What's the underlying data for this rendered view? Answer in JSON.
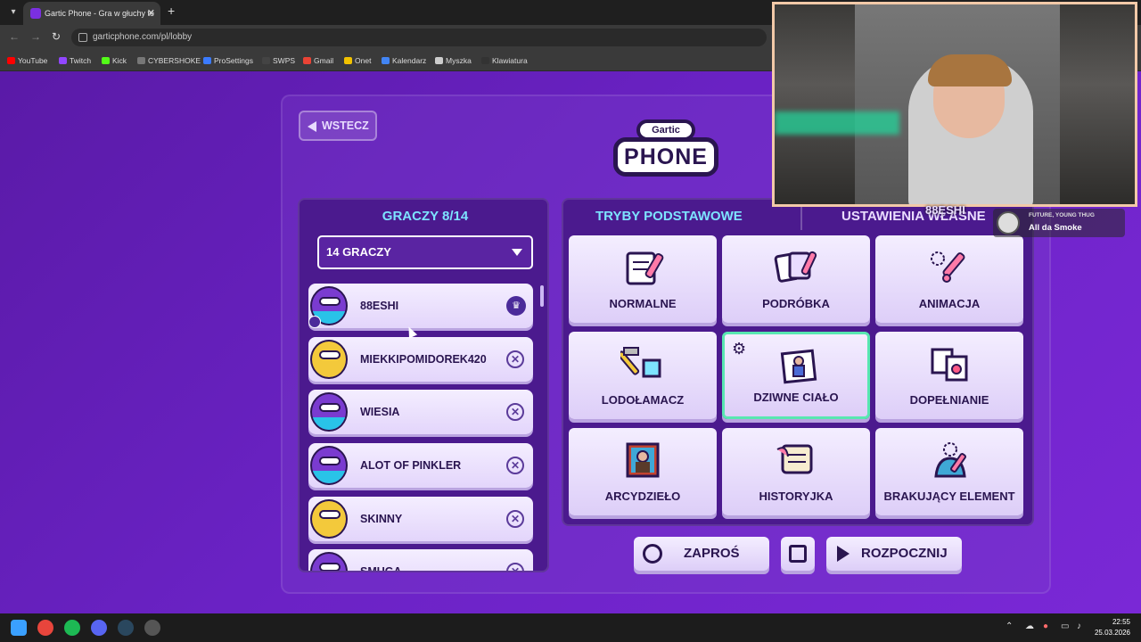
{
  "browser": {
    "tab_title": "Gartic Phone - Gra w głuchy te",
    "url": "garticphone.com/pl/lobby",
    "bookmarks": [
      "YouTube",
      "Twitch",
      "Kick",
      "CYBERSHOKE",
      "ProSettings",
      "SWPS",
      "Gmail",
      "Onet",
      "Kalendarz",
      "Myszka",
      "Klawiatura"
    ]
  },
  "page": {
    "back_label": "WSTECZ",
    "logo_top": "Gartic",
    "logo_bottom": "PHONE",
    "players_title": "GRACZY 8/14",
    "player_count_select": "14 GRACZY",
    "players": [
      {
        "name": "88ESHI",
        "host": true
      },
      {
        "name": "MIEKKIPOMIDOREK420",
        "host": false
      },
      {
        "name": "WIESIA",
        "host": false
      },
      {
        "name": "ALOT OF PINKLER",
        "host": false
      },
      {
        "name": "SKINNY",
        "host": false
      },
      {
        "name": "SMUGA",
        "host": false
      }
    ],
    "modes_tab_active": "TRYBY PODSTAWOWE",
    "modes_tab_other": "USTAWIENIA WŁASNE",
    "modes": [
      {
        "label": "NORMALNE",
        "icon": "notebook-pencil-icon",
        "selected": false
      },
      {
        "label": "PODRÓBKA",
        "icon": "cards-pencil-icon",
        "selected": false
      },
      {
        "label": "ANIMACJA",
        "icon": "animation-pencil-icon",
        "selected": false
      },
      {
        "label": "LODOŁAMACZ",
        "icon": "icebreaker-icon",
        "selected": false
      },
      {
        "label": "DZIWNE CIAŁO",
        "icon": "strange-body-icon",
        "selected": true
      },
      {
        "label": "DOPEŁNIANIE",
        "icon": "complement-icon",
        "selected": false
      },
      {
        "label": "ARCYDZIEŁO",
        "icon": "masterpiece-icon",
        "selected": false
      },
      {
        "label": "HISTORYJKA",
        "icon": "story-scroll-icon",
        "selected": false
      },
      {
        "label": "BRAKUJĄCY ELEMENT",
        "icon": "missing-piece-icon",
        "selected": false
      }
    ],
    "invite_label": "ZAPROŚ",
    "start_label": "ROZPOCZNIJ"
  },
  "overlay": {
    "streamer_name": "88ESHI",
    "now_playing_artist": "FUTURE, YOUNG THUG",
    "now_playing_track": "All da Smoke"
  },
  "taskbar": {
    "time": "22:55",
    "date": "25.03.2026"
  },
  "colors": {
    "accent_cyan": "#7de3ff",
    "selected_border": "#58e7b1",
    "panel": "#4b1a8e",
    "card_text": "#2a1550"
  }
}
